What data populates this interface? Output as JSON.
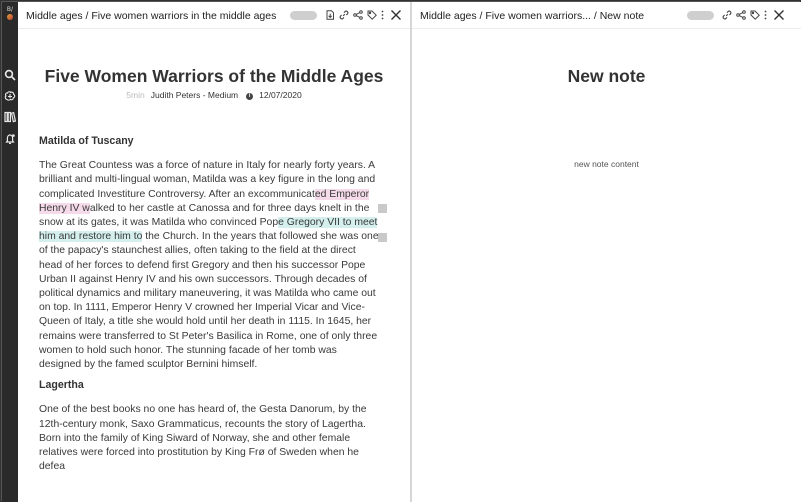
{
  "left_pane": {
    "breadcrumb": "Middle ages / Five women warriors in the middle ages",
    "title": "Five Women Warriors of the Middle Ages",
    "meta": {
      "read_time": "5min",
      "author": "Judith Peters - Medium",
      "date": "12/07/2020"
    },
    "sections": [
      {
        "heading": "Matilda of Tuscany",
        "p_before_pink": "The Great Countess was a force of nature in Italy for nearly forty years. A brilliant and multi-lingual woman, Matilda was a key figure in the long and complicated Investiture Controversy. After an excommunicat",
        "pink": "ed Emperor Henry IV w",
        "p_mid": "alked to her castle at Canossa and for three days knelt in the snow at its gates, it was Matilda who convinced Pop",
        "teal": "e Gregory VII to meet him and restore him to",
        "p_after": " the Church. In the years that followed she was one of the papacy's staunchest allies, often taking to the field at the direct head of her forces to defend first Gregory and then his successor Pope Urban II against Henry IV and his own successors. Through decades of political dynamics and military maneuvering, it was Matilda who came out on top. In 1111, Emperor Henry V crowned her Imperial Vicar and Vice-Queen of Italy, a title she would hold until her death in 1115. In 1645, her remains were transferred to St Peter's Basilica in Rome, one of only three women to hold such honor. The stunning facade of her tomb was designed by the famed sculptor Bernini himself."
      },
      {
        "heading": "Lagertha",
        "text": "One of the best books no one has heard of, the Gesta Danorum, by the 12th-century monk, Saxo Grammaticus, recounts the story of Lagertha. Born into the family of King Siward of Norway, she and other female relatives were forced into prostitution by King Frø of Sweden when he defea"
      }
    ]
  },
  "right_pane": {
    "breadcrumb": "Middle ages / Five women warriors... / New note",
    "title": "New note",
    "content": "new note content"
  },
  "rail": {
    "logo_text": "B/"
  },
  "icons": [
    "search-icon",
    "brain-icon",
    "library-icon",
    "bell-icon",
    "download-icon",
    "link-icon",
    "share-icon",
    "tag-icon",
    "more-vertical-icon",
    "close-icon"
  ],
  "colors": {
    "highlight_pink": "#f5dbe9",
    "highlight_teal": "#d4efed",
    "rail": "#2a2a2a"
  }
}
